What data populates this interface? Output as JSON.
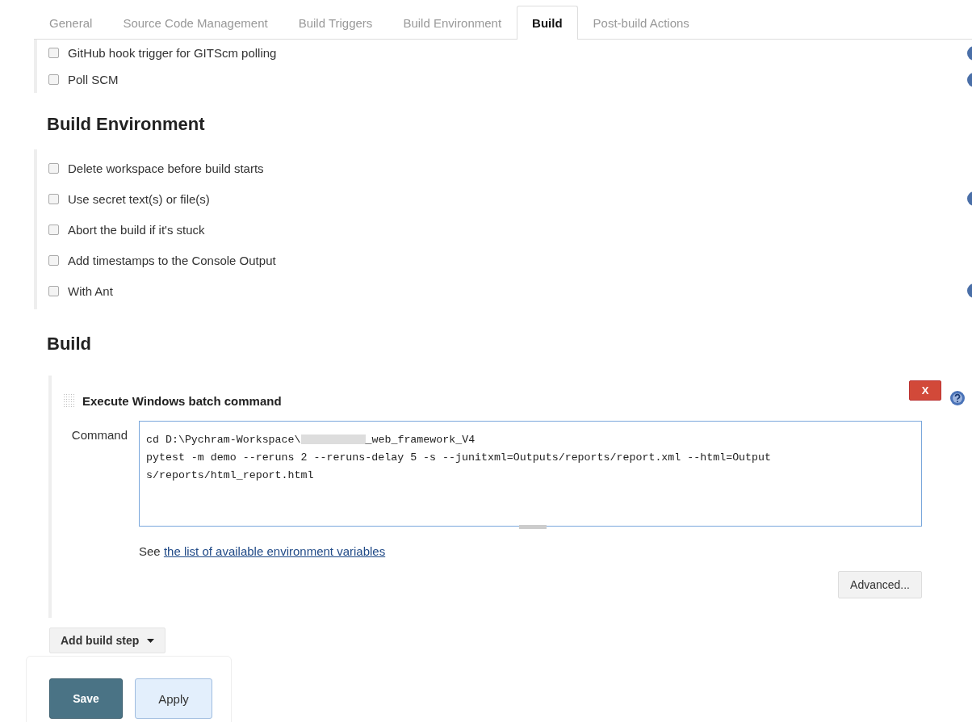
{
  "tabs": [
    {
      "label": "General",
      "selected": false
    },
    {
      "label": "Source Code Management",
      "selected": false
    },
    {
      "label": "Build Triggers",
      "selected": false
    },
    {
      "label": "Build Environment",
      "selected": false
    },
    {
      "label": "Build",
      "selected": true
    },
    {
      "label": "Post-build Actions",
      "selected": false
    }
  ],
  "build_triggers": {
    "options": [
      {
        "label": "GitHub hook trigger for GITScm polling",
        "checked": false,
        "has_help": true
      },
      {
        "label": "Poll SCM",
        "checked": false,
        "has_help": true
      }
    ]
  },
  "build_environment": {
    "heading": "Build Environment",
    "options": [
      {
        "label": "Delete workspace before build starts",
        "checked": false,
        "has_help": false
      },
      {
        "label": "Use secret text(s) or file(s)",
        "checked": false,
        "has_help": true
      },
      {
        "label": "Abort the build if it's stuck",
        "checked": false,
        "has_help": false
      },
      {
        "label": "Add timestamps to the Console Output",
        "checked": false,
        "has_help": false
      },
      {
        "label": "With Ant",
        "checked": false,
        "has_help": true
      }
    ]
  },
  "build": {
    "heading": "Build",
    "step": {
      "title": "Execute Windows batch command",
      "delete_label": "X",
      "field_label": "Command",
      "command_start": "cd D:\\Pychram-Workspace\\",
      "command_end": "_web_framework_V4",
      "command_lines": [
        "pytest -m demo --reruns 2 --reruns-delay 5 -s --junitxml=Outputs/reports/report.xml --html=Output",
        "s/reports/html_report.html"
      ],
      "hint_prefix": "See",
      "hint_link": "the list of available environment variables",
      "advanced_button": "Advanced..."
    },
    "add_step_button": "Add build step"
  },
  "actions": {
    "save": "Save",
    "apply": "Apply"
  }
}
